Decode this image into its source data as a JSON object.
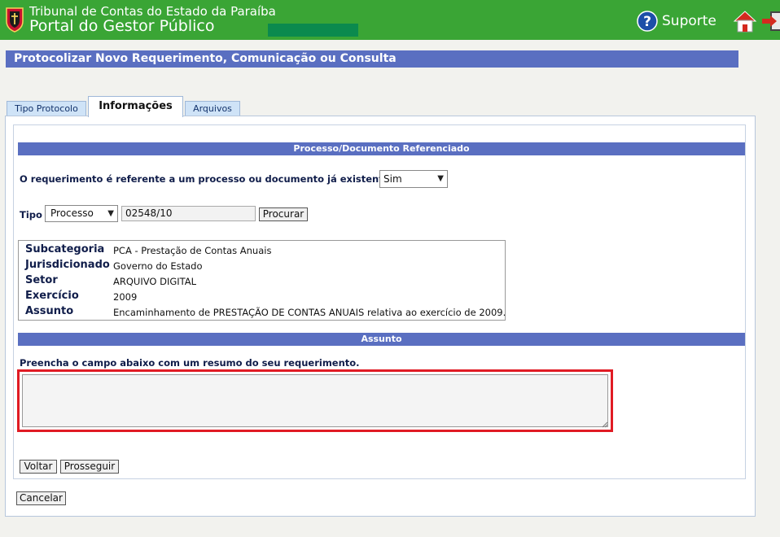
{
  "header": {
    "org_name": "Tribunal de Contas do Estado da Paraíba",
    "portal_name": "Portal do Gestor Público",
    "support_label": "Suporte",
    "icons": {
      "logo": "shield-logo-icon",
      "support": "help-circle-icon",
      "home": "home-icon",
      "exit": "exit-icon"
    },
    "colors": {
      "header_bg": "#3aa535",
      "title_bar_bg": "#5a6fc1",
      "highlight_border": "#e01b24"
    }
  },
  "page_title": "Protocolizar Novo Requerimento, Comunicação ou Consulta",
  "tabs": [
    {
      "label": "Tipo Protocolo",
      "active": false
    },
    {
      "label": "Informações",
      "active": true
    },
    {
      "label": "Arquivos",
      "active": false
    }
  ],
  "processo_section": {
    "header": "Processo/Documento Referenciado",
    "question": "O requerimento é referente a um processo ou documento já existente?",
    "existing_select_value": "Sim",
    "tipo_label": "Tipo",
    "tipo_select_value": "Processo",
    "numero_value": "02548/10",
    "search_button": "Procurar"
  },
  "details": [
    {
      "key": "Subcategoria",
      "value": "PCA - Prestação de Contas Anuais"
    },
    {
      "key": "Jurisdicionado",
      "value": "Governo do Estado"
    },
    {
      "key": "Setor",
      "value": "ARQUIVO DIGITAL"
    },
    {
      "key": "Exercício",
      "value": "2009"
    },
    {
      "key": "Assunto",
      "value": "Encaminhamento de PRESTAÇÃO DE CONTAS ANUAIS relativa ao exercício de 2009."
    }
  ],
  "assunto_section": {
    "header": "Assunto",
    "hint": "Preencha o campo abaixo com um resumo do seu requerimento.",
    "textarea_value": ""
  },
  "buttons": {
    "back": "Voltar",
    "next": "Prosseguir",
    "cancel": "Cancelar"
  }
}
